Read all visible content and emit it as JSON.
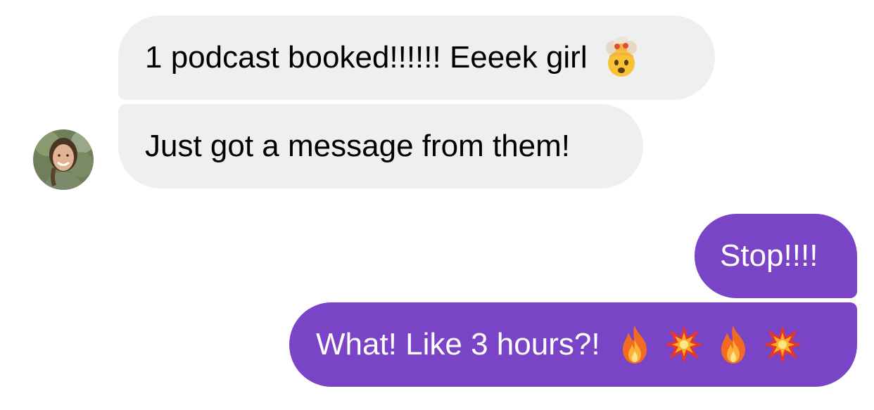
{
  "conversation": {
    "messages": [
      {
        "direction": "incoming",
        "text": "1 podcast booked!!!!!! Eeeek girl",
        "emoji": [
          "exploding-head"
        ]
      },
      {
        "direction": "incoming",
        "text": "Just got a message from them!"
      },
      {
        "direction": "outgoing",
        "text": "Stop!!!!"
      },
      {
        "direction": "outgoing",
        "text": "What! Like 3 hours?!",
        "emoji": [
          "fire",
          "collision",
          "fire",
          "collision"
        ]
      }
    ]
  },
  "contact": {
    "avatar_icon": "contact-avatar"
  },
  "colors": {
    "incoming_bubble": "#efefef",
    "outgoing_bubble": "#7a44c6",
    "incoming_text": "#000000",
    "outgoing_text": "#ffffff"
  }
}
